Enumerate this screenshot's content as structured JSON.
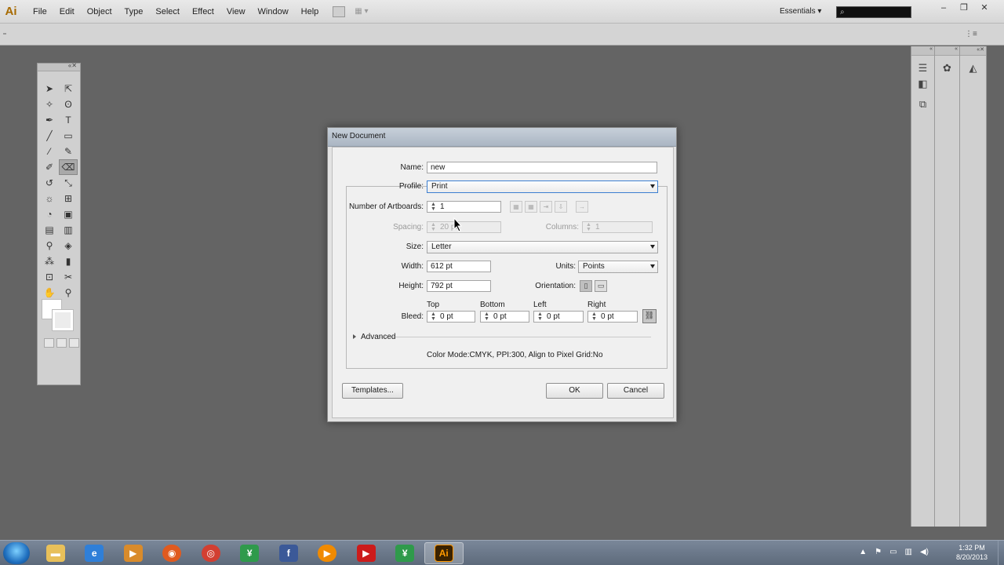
{
  "app": {
    "logo": "Ai",
    "menus": [
      "File",
      "Edit",
      "Object",
      "Type",
      "Select",
      "Effect",
      "View",
      "Window",
      "Help"
    ],
    "workspace_switcher": "Essentials",
    "search_placeholder": ""
  },
  "dialog": {
    "title": "New Document",
    "name_label": "Name:",
    "name_value": "new",
    "profile_label": "Profile:",
    "profile_value": "Print",
    "artboards_label": "Number of Artboards:",
    "artboards_value": "1",
    "spacing_label": "Spacing:",
    "spacing_value": "20 pt",
    "columns_label": "Columns:",
    "columns_value": "1",
    "size_label": "Size:",
    "size_value": "Letter",
    "width_label": "Width:",
    "width_value": "612 pt",
    "units_label": "Units:",
    "units_value": "Points",
    "height_label": "Height:",
    "height_value": "792 pt",
    "orientation_label": "Orientation:",
    "bleed_label": "Bleed:",
    "bleed": {
      "top_label": "Top",
      "top_value": "0 pt",
      "bottom_label": "Bottom",
      "bottom_value": "0 pt",
      "left_label": "Left",
      "left_value": "0 pt",
      "right_label": "Right",
      "right_value": "0 pt"
    },
    "advanced_label": "Advanced",
    "summary": "Color Mode:CMYK, PPI:300, Align to Pixel Grid:No",
    "templates_button": "Templates...",
    "ok_button": "OK",
    "cancel_button": "Cancel"
  },
  "taskbar": {
    "time": "1:32 PM",
    "date": "8/20/2013"
  }
}
